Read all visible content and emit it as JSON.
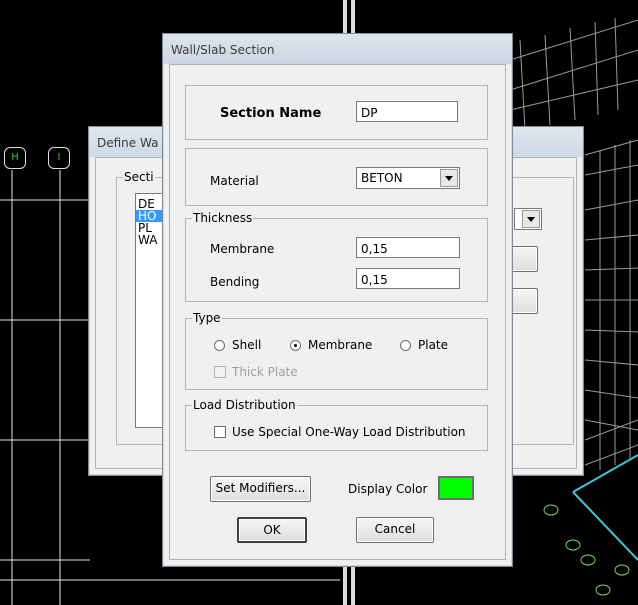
{
  "background": {
    "axis_bubbles": [
      "H",
      "I"
    ]
  },
  "define_dialog": {
    "title": "Define Wa",
    "group_label": "Secti",
    "list_items": [
      "DE",
      "HO",
      "PL",
      "WA"
    ],
    "selected_index": 1
  },
  "dialog": {
    "title": "Wall/Slab Section",
    "section_name_label": "Section Name",
    "section_name_value": "DP",
    "material_label": "Material",
    "material_value": "BETON",
    "thickness": {
      "legend": "Thickness",
      "membrane_label": "Membrane",
      "membrane_value": "0,15",
      "bending_label": "Bending",
      "bending_value": "0,15"
    },
    "type": {
      "legend": "Type",
      "options": [
        "Shell",
        "Membrane",
        "Plate"
      ],
      "selected": "Membrane",
      "thick_plate_label": "Thick Plate",
      "thick_plate_checked": false
    },
    "load_distribution": {
      "legend": "Load Distribution",
      "checkbox_label": "Use Special One-Way Load Distribution",
      "checked": false
    },
    "set_modifiers_label": "Set Modifiers...",
    "display_color_label": "Display Color",
    "display_color": "#00ff00",
    "ok_label": "OK",
    "cancel_label": "Cancel"
  }
}
